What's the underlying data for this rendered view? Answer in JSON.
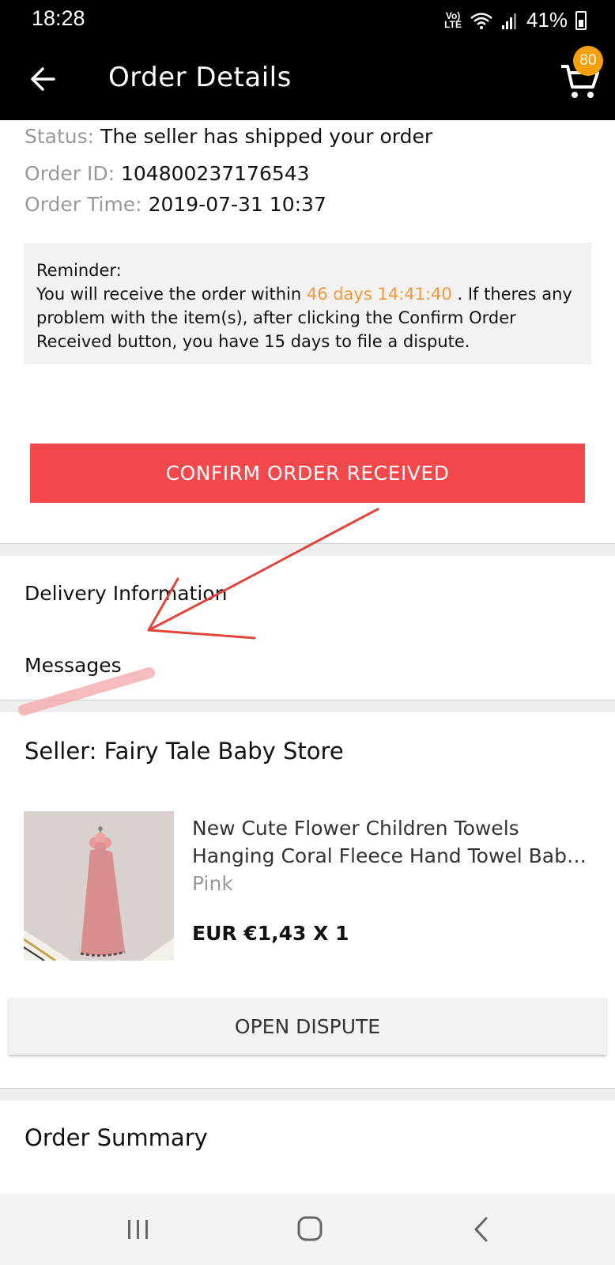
{
  "status_bar": {
    "time": "18:28",
    "network_label_top": "Vo)",
    "network_label_bottom": "LTE",
    "battery_percent": "41%"
  },
  "app_bar": {
    "title": "Order Details",
    "cart_badge": "80"
  },
  "order": {
    "status_label": "Status:",
    "status_value": "The seller has shipped your order",
    "id_label": "Order ID:",
    "id_value": "104800237176543",
    "time_label": "Order Time:",
    "time_value": "2019-07-31 10:37"
  },
  "reminder": {
    "title": "Reminder:",
    "text_before": "You will receive the order within ",
    "countdown": "46 days 14:41:40",
    "text_after": " . If theres any problem with the item(s), after clicking the Confirm Order Received button, you have 15 days to file a dispute."
  },
  "actions": {
    "confirm_label": "CONFIRM ORDER RECEIVED",
    "dispute_label": "OPEN DISPUTE"
  },
  "menu": {
    "delivery_info": "Delivery Information",
    "messages": "Messages"
  },
  "seller": {
    "label": "Seller: Fairy Tale Baby Store"
  },
  "product": {
    "title_line1": "New Cute Flower Children Towels",
    "title_line2": "Hanging Coral Fleece Hand Towel Baby ...",
    "variant": "Pink",
    "price": "EUR €1,43 X 1"
  },
  "summary": {
    "title": "Order Summary"
  },
  "colors": {
    "confirm_button": "#f5484d",
    "countdown": "#f09a3b",
    "cart_badge": "#f59f0a",
    "annotation_arrow": "#e0463c"
  },
  "icons": {
    "back": "arrow-left-icon",
    "cart": "shopping-cart-icon",
    "nav_recent": "recent-apps-icon",
    "nav_home": "home-icon",
    "nav_back": "nav-back-icon"
  }
}
